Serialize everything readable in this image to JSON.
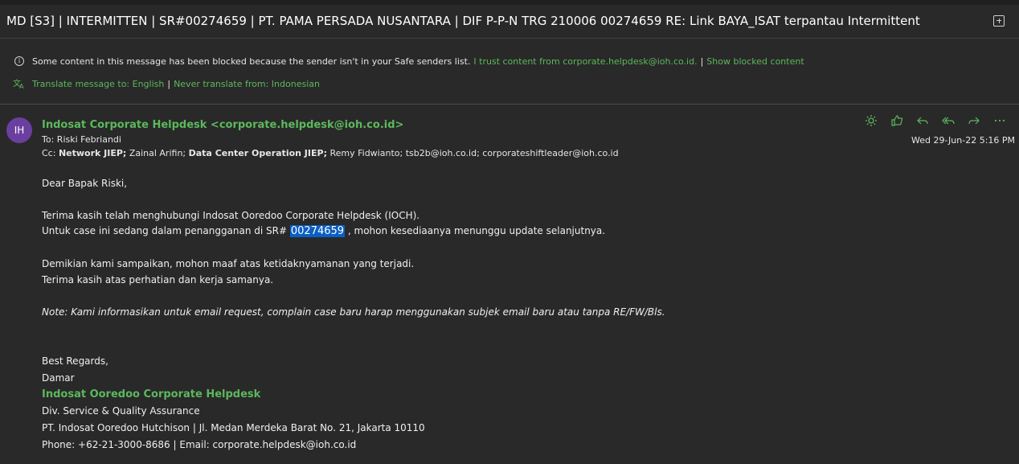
{
  "subject": "MD [S3] | INTERMITTEN | SR#00274659 | PT. PAMA PERSADA NUSANTARA | DIF P-P-N TRG 210006 00274659 RE: Link BAYA_ISAT terpantau Intermittent",
  "notice": {
    "text": "Some content in this message has been blocked because the sender isn't in your Safe senders list.",
    "trust_link": "I trust content from corporate.helpdesk@ioh.co.id.",
    "separator": "|",
    "show_link": "Show blocked content"
  },
  "translate": {
    "translate_link": "Translate message to: English",
    "separator": "|",
    "never_link": "Never translate from: Indonesian"
  },
  "message": {
    "avatar_initials": "IH",
    "sender": "Indosat Corporate Helpdesk <corporate.helpdesk@ioh.co.id>",
    "to_label": "To:",
    "to": "Riski Febriandi",
    "cc_label": "Cc:",
    "cc": [
      {
        "name": "Network JIEP;",
        "bold": true
      },
      {
        "name": "Zainal Arifin;",
        "bold": false
      },
      {
        "name": "Data Center Operation JIEP;",
        "bold": true
      },
      {
        "name": "Remy Fidwianto;",
        "bold": false
      },
      {
        "name": "tsb2b@ioh.co.id;",
        "bold": false
      },
      {
        "name": "corporateshiftleader@ioh.co.id",
        "bold": false
      }
    ],
    "date": "Wed 29-Jun-22 5:16 PM",
    "actions": [
      "sun-icon",
      "like-icon",
      "reply-icon",
      "reply-all-icon",
      "forward-icon",
      "more-icon"
    ]
  },
  "body": {
    "greeting": "Dear Bapak Riski,",
    "line1": "Terima kasih telah menghubungi Indosat Ooredoo Corporate Helpdesk (IOCH).",
    "line2_pre": "Untuk case ini sedang dalam penangganan di SR#",
    "sr_number": "00274659",
    "line2_post": ", mohon kesediaanya menunggu update selanjutnya.",
    "line3": "Demikian kami sampaikan, mohon maaf atas ketidaknyamanan yang terjadi.",
    "line4": "Terima kasih atas perhatian dan kerja samanya.",
    "note": "Note: Kami informasikan untuk email request, complain  case baru harap menggunakan subjek email baru atau tanpa RE/FW/Bls.",
    "regards": "Best Regards,",
    "name": "Damar",
    "org": "Indosat Ooredoo Corporate Helpdesk",
    "div": "Div. Service & Quality Assurance",
    "address": "PT. Indosat Ooredoo Hutchison  | Jl. Medan Merdeka Barat No. 21, Jakarta 10110",
    "contact": "Phone: +62-21-3000-8686 | Email: corporate.helpdesk@ioh.co.id"
  },
  "colors": {
    "background": "#292929",
    "accent": "#5cb85c",
    "avatar": "#6b3fa0",
    "highlight": "#0a5fc4"
  }
}
